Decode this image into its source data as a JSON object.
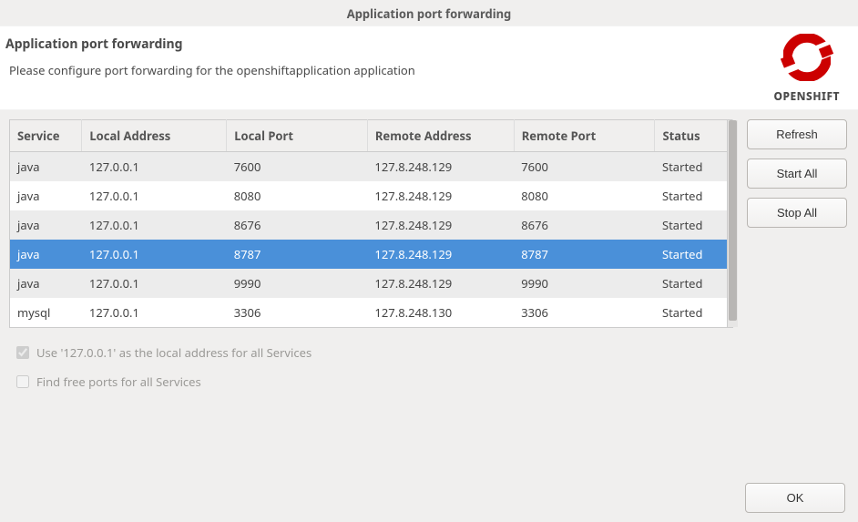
{
  "window": {
    "title": "Application port forwarding"
  },
  "header": {
    "title": "Application port forwarding",
    "description": "Please configure port forwarding for the openshiftapplication application",
    "brand": "OPENSHIFT"
  },
  "table": {
    "columns": {
      "service": "Service",
      "local_address": "Local Address",
      "local_port": "Local Port",
      "remote_address": "Remote Address",
      "remote_port": "Remote Port",
      "status": "Status"
    },
    "rows": [
      {
        "service": "java",
        "laddr": "127.0.0.1",
        "lport": "7600",
        "raddr": "127.8.248.129",
        "rport": "7600",
        "status": "Started",
        "selected": false
      },
      {
        "service": "java",
        "laddr": "127.0.0.1",
        "lport": "8080",
        "raddr": "127.8.248.129",
        "rport": "8080",
        "status": "Started",
        "selected": false
      },
      {
        "service": "java",
        "laddr": "127.0.0.1",
        "lport": "8676",
        "raddr": "127.8.248.129",
        "rport": "8676",
        "status": "Started",
        "selected": false
      },
      {
        "service": "java",
        "laddr": "127.0.0.1",
        "lport": "8787",
        "raddr": "127.8.248.129",
        "rport": "8787",
        "status": "Started",
        "selected": true
      },
      {
        "service": "java",
        "laddr": "127.0.0.1",
        "lport": "9990",
        "raddr": "127.8.248.129",
        "rport": "9990",
        "status": "Started",
        "selected": false
      },
      {
        "service": "mysql",
        "laddr": "127.0.0.1",
        "lport": "3306",
        "raddr": "127.8.248.130",
        "rport": "3306",
        "status": "Started",
        "selected": false
      }
    ]
  },
  "buttons": {
    "refresh": "Refresh",
    "start_all": "Start All",
    "stop_all": "Stop All",
    "ok": "OK"
  },
  "checkboxes": {
    "use_local": {
      "label": "Use '127.0.0.1' as the local address for all Services",
      "checked": true,
      "enabled": false
    },
    "free_ports": {
      "label": "Find free ports for all Services",
      "checked": false,
      "enabled": false
    }
  }
}
